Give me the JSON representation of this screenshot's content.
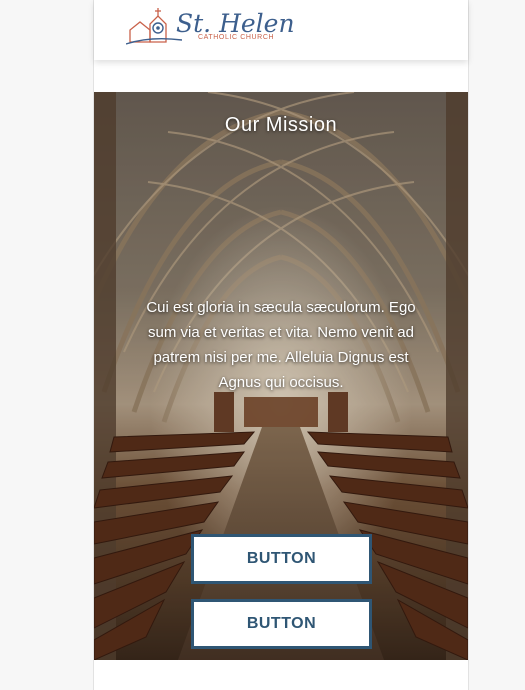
{
  "header": {
    "logo_name": "St. Helen",
    "logo_subtitle": "CATHOLIC CHURCH"
  },
  "hero": {
    "title": "Our Mission",
    "body": "Cui est gloria in sæcula sæculorum. Ego sum via et veritas et vita. Nemo venit ad patrem nisi per me. Alleluia Dignus est Agnus qui occisus."
  },
  "buttons": [
    {
      "label": "BUTTON"
    },
    {
      "label": "BUTTON"
    }
  ],
  "colors": {
    "brand_blue": "#3d5f8d",
    "brand_orange": "#c9624a",
    "button_border": "#2f5674"
  }
}
